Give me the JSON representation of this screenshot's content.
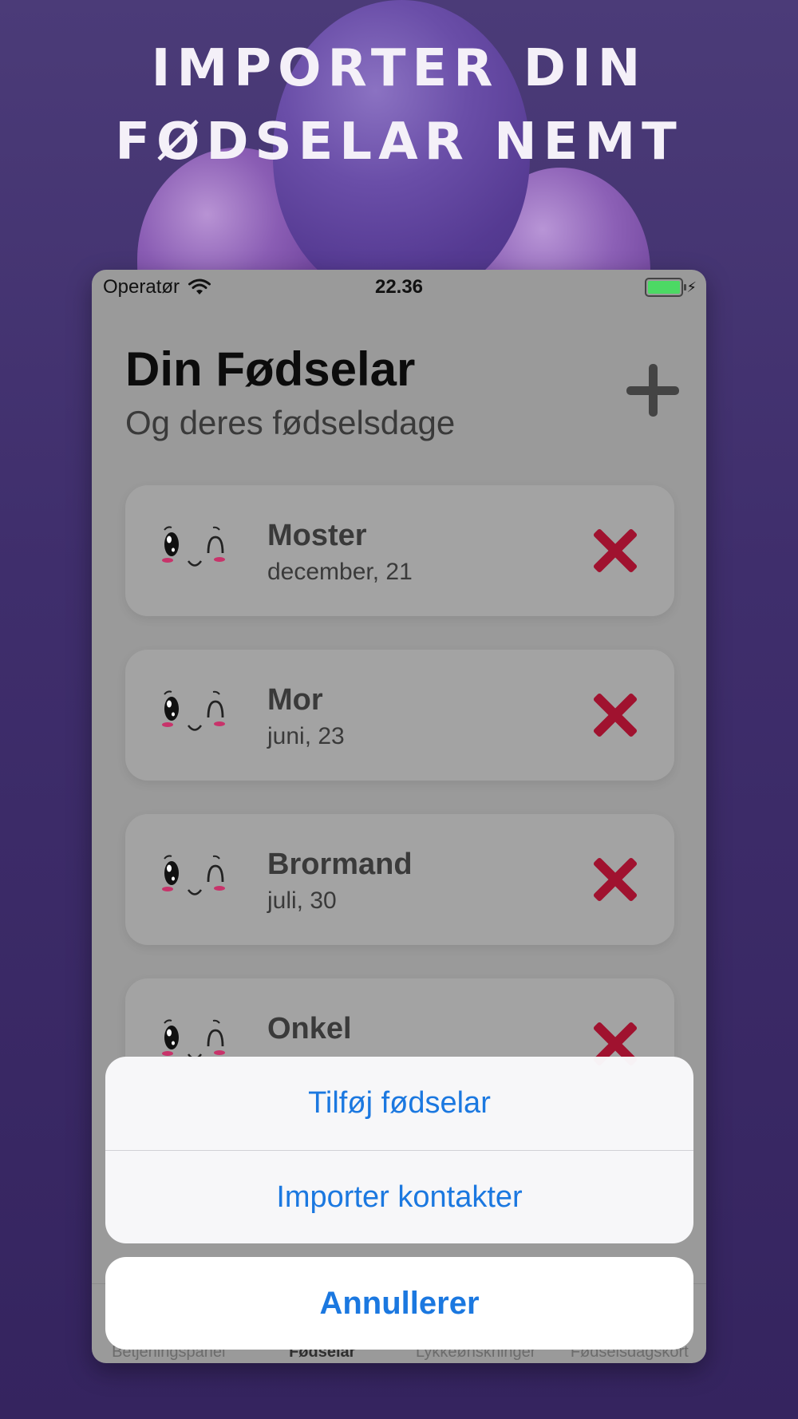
{
  "headline": {
    "line1": "IMPORTER DIN",
    "line2": "FØDSELAR NEMT"
  },
  "status_bar": {
    "carrier": "Operatør",
    "time": "22.36"
  },
  "screen": {
    "title": "Din Fødselar",
    "subtitle": "Og deres fødselsdage",
    "contacts": [
      {
        "name": "Moster",
        "date": "december, 21"
      },
      {
        "name": "Mor",
        "date": "juni, 23"
      },
      {
        "name": "Brormand",
        "date": "juli, 30"
      },
      {
        "name": "Onkel",
        "date": ""
      }
    ]
  },
  "tabbar": {
    "tabs": [
      "Betjeningspanel",
      "Fødselar",
      "Lykkeønskninger",
      "Fødselsdagskort"
    ],
    "active": "Fødselar"
  },
  "action_sheet": {
    "items": [
      "Tilføj fødselar",
      "Importer kontakter"
    ],
    "cancel": "Annullerer"
  },
  "colors": {
    "accent": "#1b78e0",
    "delete": "#a0122f",
    "battery": "#4cd964",
    "background": "#3f2e6c"
  }
}
